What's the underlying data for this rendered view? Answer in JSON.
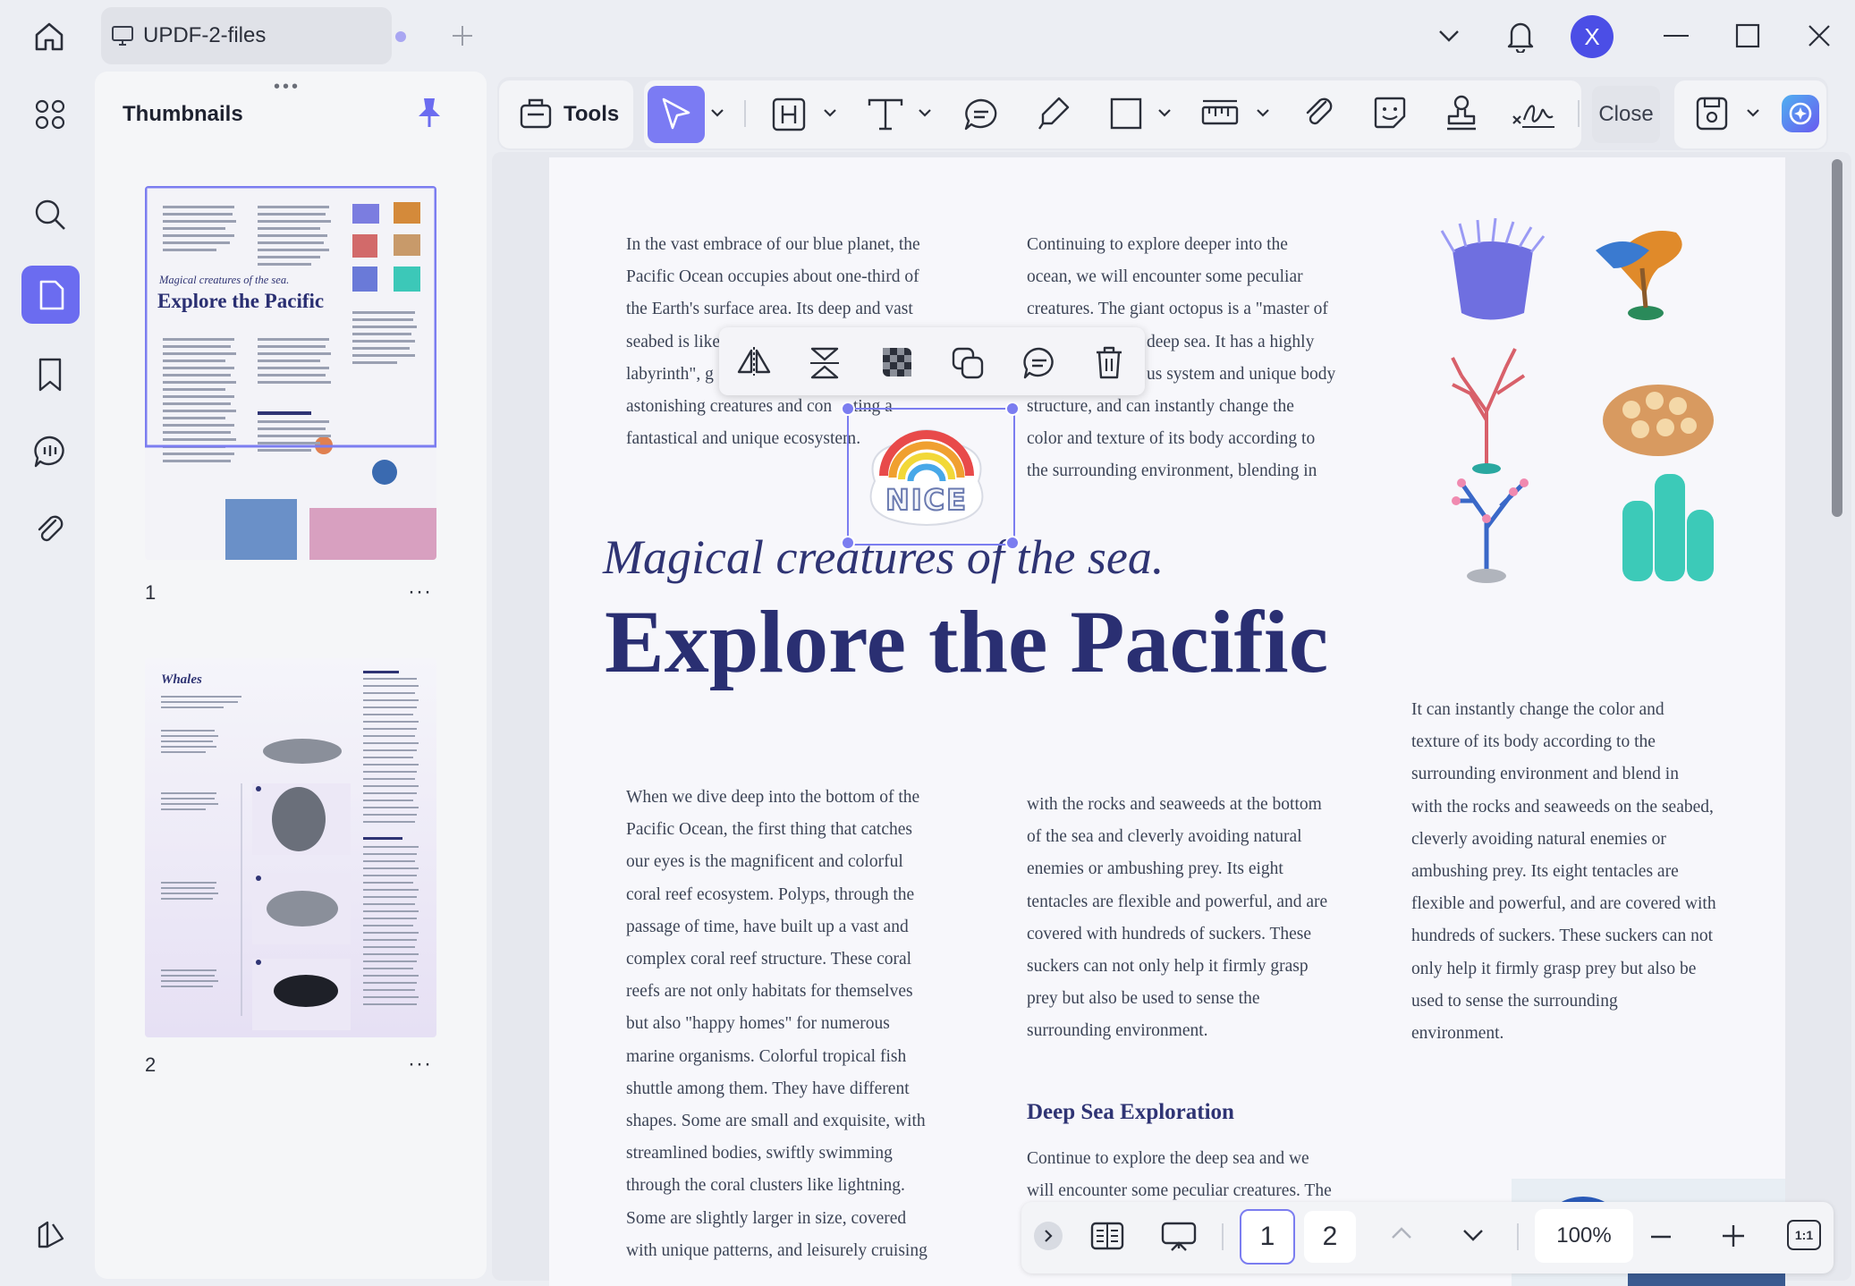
{
  "window": {
    "tab_title": "UPDF-2-files",
    "avatar_initial": "X"
  },
  "thumbnails": {
    "title": "Thumbnails",
    "pages": [
      {
        "number": "1",
        "more": "···"
      },
      {
        "number": "2",
        "more": "···"
      }
    ],
    "mini_page1_title": "Explore the Pacific",
    "mini_page1_subtitle": "Magical creatures of the sea.",
    "mini_page2_title": "Whales"
  },
  "toolbar": {
    "tools_label": "Tools",
    "close_label": "Close"
  },
  "document": {
    "col1_top": [
      "In the vast embrace of our blue planet, the",
      "Pacific Ocean occupies about one-third of",
      "the Earth's surface area. Its deep and vast",
      "seabed is like",
      "labyrinth\", g",
      "astonishing creatures and con",
      "fantastical and unique ecosystem."
    ],
    "col1_top_tails": [
      "uting a"
    ],
    "col2_top": [
      "Continuing to explore deeper into the",
      "ocean, we will encounter some peculiar",
      "creatures. The giant octopus is a \"master of",
      "deep sea. It has a highly",
      "us system and unique body",
      "structure, and can instantly change the",
      "color and texture of its body according to",
      "the surrounding environment, blending in"
    ],
    "subtitle": "Magical creatures of the sea.",
    "title": "Explore the Pacific",
    "col1_bottom": [
      "When we dive deep into the bottom of the",
      "Pacific Ocean, the first thing that catches",
      "our eyes is the magnificent and colorful",
      "coral reef ecosystem. Polyps, through the",
      "passage of time, have built up a vast and",
      "complex coral reef structure. These coral",
      "reefs are not only habitats for themselves",
      "but also \"happy homes\" for numerous",
      "marine organisms. Colorful tropical fish",
      "shuttle among them. They have different",
      "shapes. Some are small and exquisite, with",
      "streamlined bodies, swiftly swimming",
      "through the coral clusters like lightning.",
      "Some are slightly larger in size, covered",
      "with unique patterns, and leisurely cruising"
    ],
    "col2_bottom": [
      "with the rocks and seaweeds at the bottom",
      "of the sea and cleverly avoiding natural",
      "enemies or ambushing prey. Its eight",
      "tentacles are flexible and powerful, and are",
      "covered with hundreds of suckers. These",
      "suckers can not only help it firmly grasp",
      "prey but also be used to sense the",
      "surrounding environment."
    ],
    "section_heading": "Deep Sea Exploration",
    "col2_section": [
      "Continue to explore the deep sea and we",
      "will encounter some peculiar creatures. The"
    ],
    "col3": [
      "It can instantly change the color and",
      "texture of its body according to the",
      "surrounding environment and blend in",
      "with the rocks and seaweeds on the seabed,",
      "cleverly avoiding natural enemies or",
      "ambushing prey. Its eight tentacles are",
      "flexible and powerful, and are covered with",
      "hundreds of suckers. These suckers can not",
      "only help it firmly grasp prey but also be",
      "used to sense the surrounding",
      "environment."
    ],
    "sticker_text": "NICE"
  },
  "bottombar": {
    "page1": "1",
    "page2": "2",
    "zoom": "100%",
    "fit_label": "1:1"
  }
}
